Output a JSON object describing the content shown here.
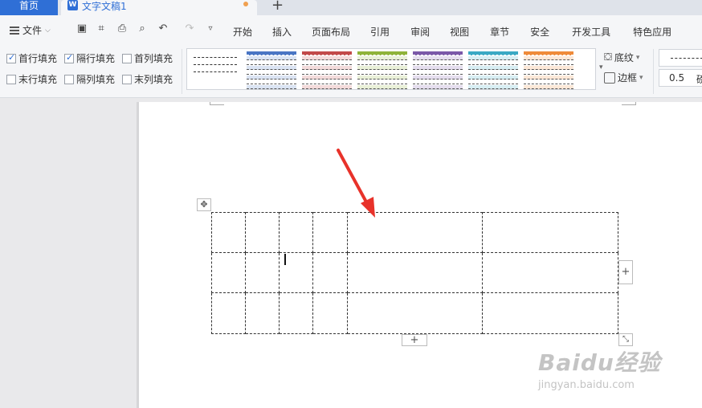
{
  "tabs": {
    "home": "首页",
    "doc_title": "文字文稿1",
    "doc_icon": "W",
    "new_tab": "+"
  },
  "menubar": {
    "file_label": "文件",
    "items": [
      "开始",
      "插入",
      "页面布局",
      "引用",
      "审阅",
      "视图",
      "章节",
      "安全",
      "开发工具",
      "特色应用"
    ]
  },
  "quick_access_icons": [
    "save-icon",
    "format-painter-icon",
    "print-icon",
    "print-preview-icon",
    "undo-icon",
    "redo-icon",
    "more-icon"
  ],
  "ribbon": {
    "checkboxes": [
      {
        "label": "首行填充",
        "checked": true
      },
      {
        "label": "隔行填充",
        "checked": true
      },
      {
        "label": "首列填充",
        "checked": false
      },
      {
        "label": "末行填充",
        "checked": false
      },
      {
        "label": "隔列填充",
        "checked": false
      },
      {
        "label": "末列填充",
        "checked": false
      }
    ],
    "style_colors": [
      "#4a76c4",
      "#c24a4a",
      "#8fb43a",
      "#7b58a8",
      "#3aa9c4",
      "#ef8b3a"
    ],
    "shading_label": "底纹",
    "border_label": "边框",
    "line_width": "0.5",
    "line_width_more": "磅"
  },
  "table": {
    "rows": 3,
    "cols_widths_note": "4 narrow + 2 wide"
  },
  "watermark": {
    "brand": "Baidu经验",
    "url": "jingyan.baidu.com"
  }
}
